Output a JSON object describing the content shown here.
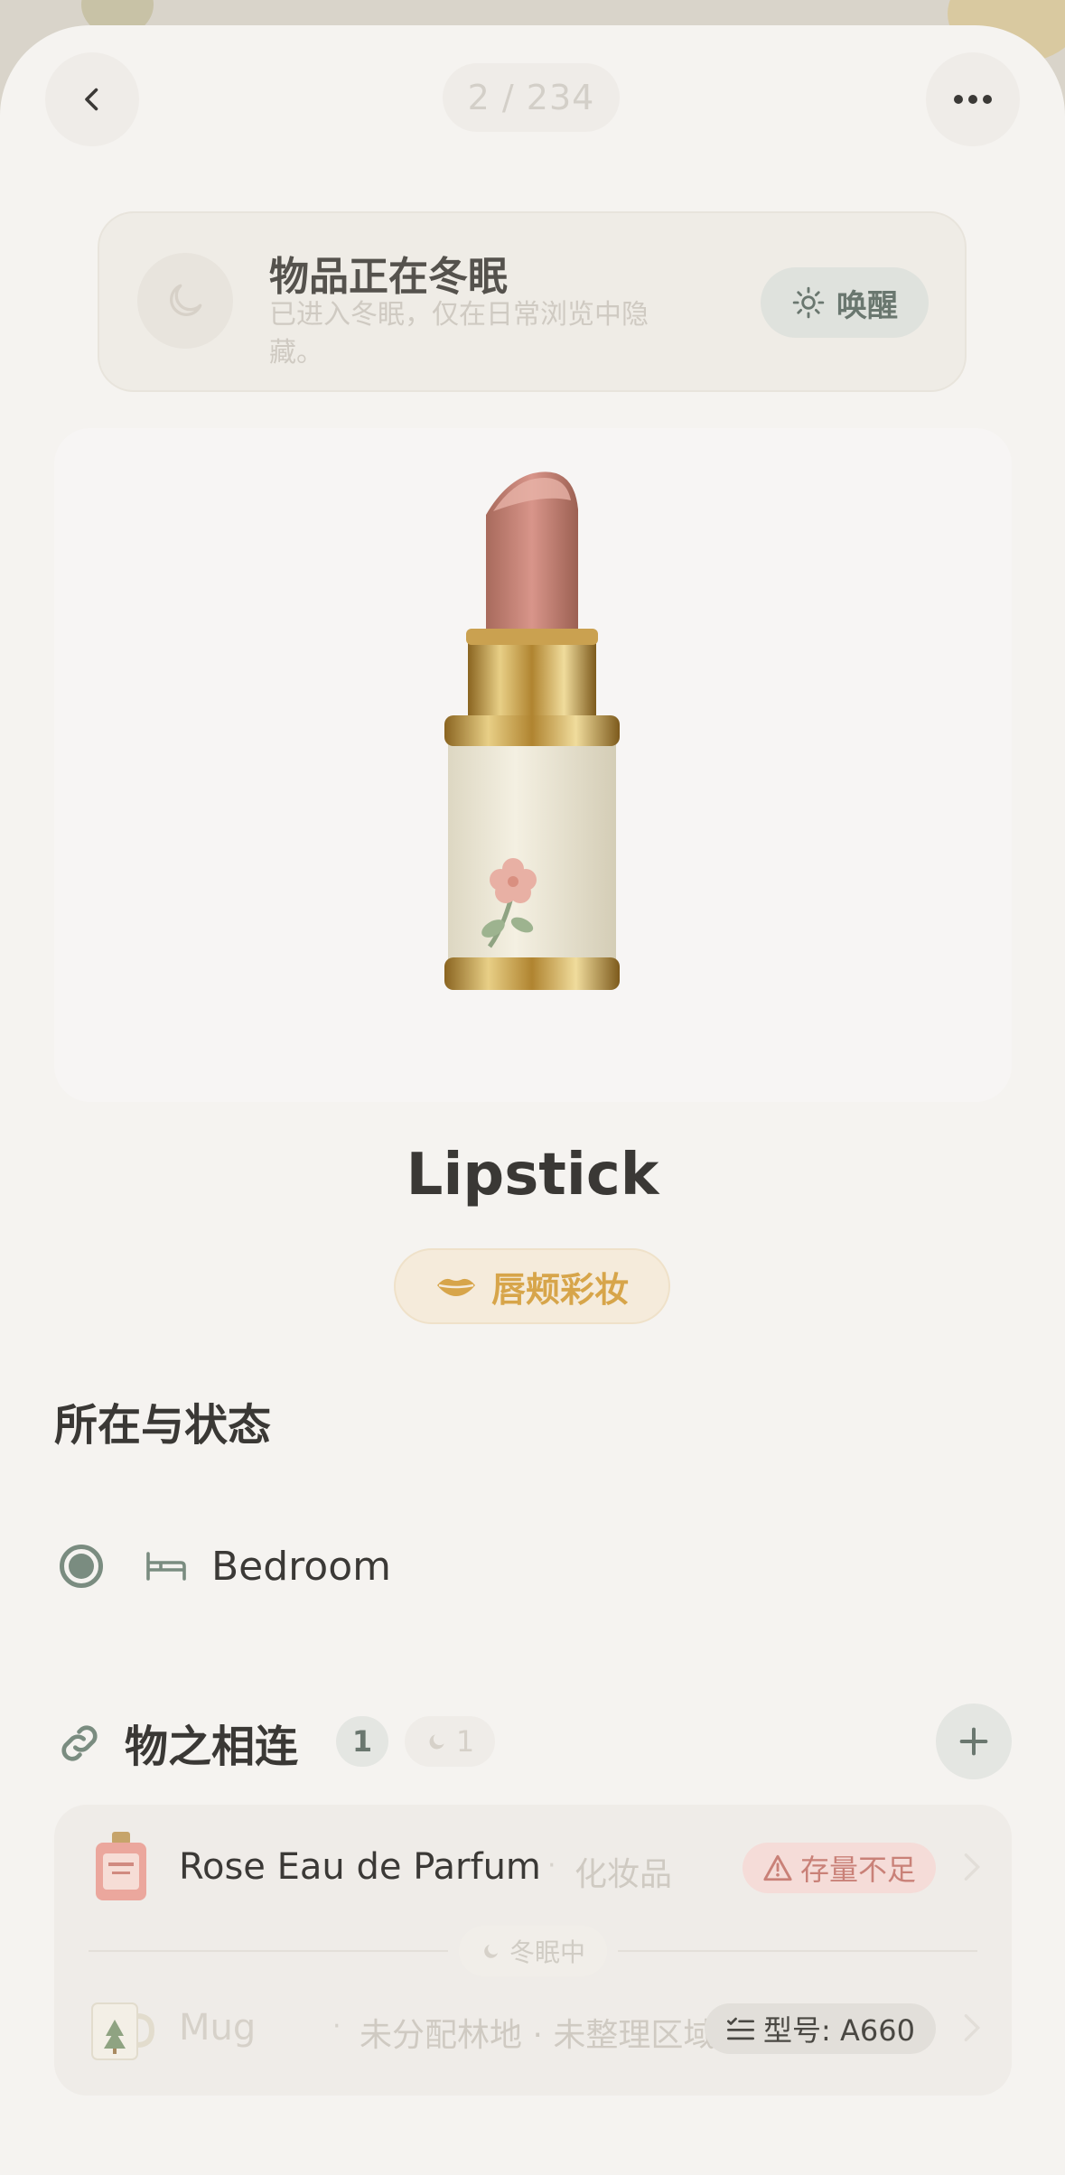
{
  "header": {
    "pager": "2 / 234"
  },
  "hibernation": {
    "title": "物品正在冬眠",
    "description": "已进入冬眠，仅在日常浏览中隐藏。",
    "wake_label": "唤醒"
  },
  "item": {
    "name": "Lipstick",
    "category": "唇颊彩妆",
    "image_icon": "lipstick-illustration"
  },
  "location_section": {
    "heading": "所在与状态",
    "location": "Bedroom"
  },
  "links_section": {
    "heading": "物之相连",
    "active_count": "1",
    "hibernating_count": "1",
    "items": [
      {
        "name": "Rose Eau de Parfum",
        "sep": "·",
        "subtitle": "化妆品",
        "badge": "存量不足",
        "icon": "perfume-bottle-icon"
      },
      {
        "name": "Mug",
        "sep": "·",
        "subtitle": "未分配林地 · 未整理区域",
        "badge": "型号: A660",
        "icon": "mug-icon"
      }
    ],
    "divider_label": "冬眠中"
  },
  "colors": {
    "accent_green": "#7a8c80",
    "category_gold": "#d7a54a",
    "warning_red": "#c98178"
  }
}
